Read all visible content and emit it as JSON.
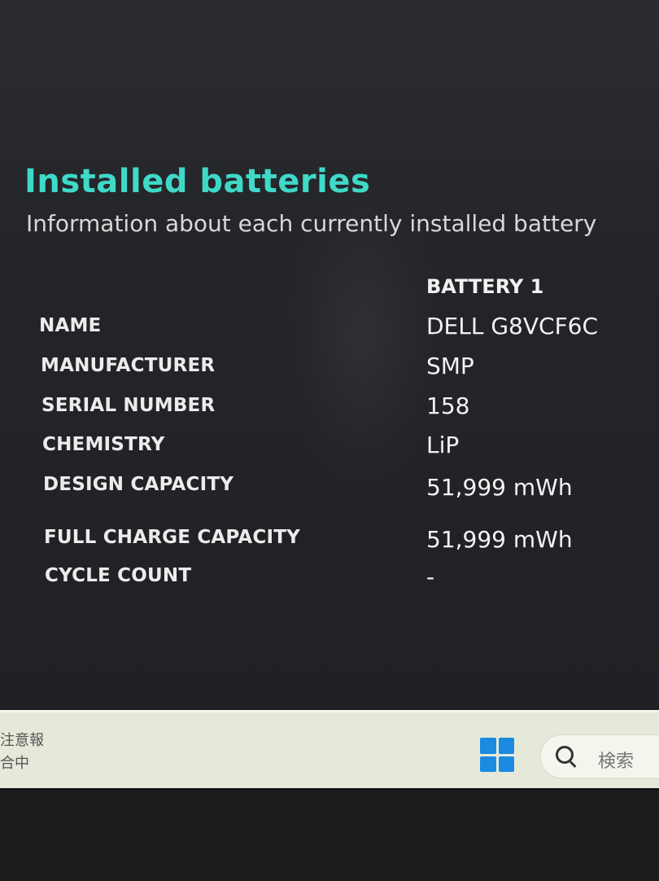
{
  "header": {
    "title": "Installed batteries",
    "subtitle": "Information about each currently installed battery"
  },
  "table": {
    "column_header": "BATTERY 1",
    "rows": [
      {
        "label": "NAME",
        "value": "DELL G8VCF6C"
      },
      {
        "label": "MANUFACTURER",
        "value": "SMP"
      },
      {
        "label": "SERIAL NUMBER",
        "value": "158"
      },
      {
        "label": "CHEMISTRY",
        "value": "LiP"
      },
      {
        "label": "DESIGN CAPACITY",
        "value": "51,999 mWh"
      },
      {
        "label": "FULL CHARGE CAPACITY",
        "value": "51,999 mWh"
      },
      {
        "label": "CYCLE COUNT",
        "value": "-"
      }
    ]
  },
  "taskbar": {
    "notice_line1": "注意報",
    "notice_line2": "合中",
    "search_placeholder": "検索",
    "start_icon": "windows-logo-icon",
    "search_icon": "search-icon"
  },
  "colors": {
    "title": "#3fd9c8",
    "background": "#232528",
    "taskbar": "#e5e9da",
    "start_icon": "#1a8be0"
  }
}
